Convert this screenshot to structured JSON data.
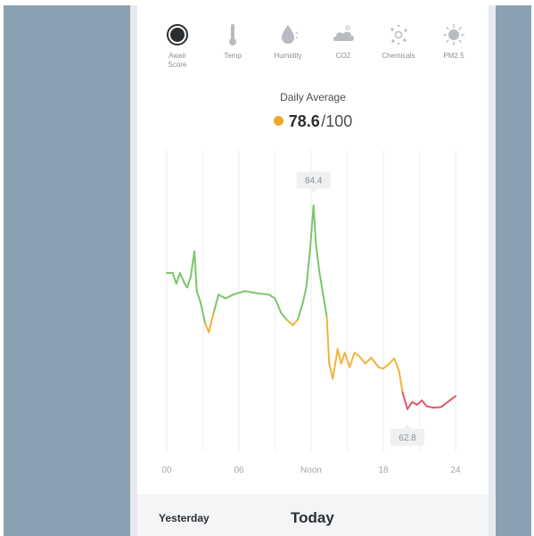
{
  "sensors": [
    {
      "label_lines": [
        "Awair",
        "Score"
      ],
      "icon": "score-ring-icon"
    },
    {
      "label_lines": [
        "Temp"
      ],
      "icon": "thermometer-icon"
    },
    {
      "label_lines": [
        "Humidity"
      ],
      "icon": "humidity-drop-icon"
    },
    {
      "label_lines": [
        "CO2"
      ],
      "icon": "co2-cloud-icon"
    },
    {
      "label_lines": [
        "Chemicals"
      ],
      "icon": "chemicals-icon"
    },
    {
      "label_lines": [
        "PM2.5"
      ],
      "icon": "pm25-icon"
    }
  ],
  "summary": {
    "label": "Daily Average",
    "value": "78.6",
    "max": "/100",
    "status_color": "#f2a52b"
  },
  "colors": {
    "good": "#7cc56b",
    "fair": "#f2b33d",
    "poor": "#e05a63"
  },
  "chart_data": {
    "type": "line",
    "x_ticks": [
      {
        "value": 0,
        "label": "00"
      },
      {
        "value": 6,
        "label": "06"
      },
      {
        "value": 12,
        "label": "Noon"
      },
      {
        "value": 18,
        "label": "18"
      },
      {
        "value": 24,
        "label": "24"
      }
    ],
    "xlim": [
      0,
      24
    ],
    "ylim": [
      55,
      96
    ],
    "grid": "vertical",
    "points": [
      [
        0.0,
        79.0
      ],
      [
        0.5,
        79.0
      ],
      [
        0.8,
        77.5
      ],
      [
        1.1,
        79.0
      ],
      [
        1.5,
        77.5
      ],
      [
        1.7,
        77.0
      ],
      [
        2.0,
        78.5
      ],
      [
        2.3,
        82.0
      ],
      [
        2.5,
        76.5
      ],
      [
        2.8,
        75.0
      ],
      [
        3.2,
        72.0
      ],
      [
        3.5,
        70.8
      ],
      [
        3.9,
        73.5
      ],
      [
        4.3,
        76.0
      ],
      [
        4.9,
        75.5
      ],
      [
        5.5,
        76.0
      ],
      [
        6.5,
        76.5
      ],
      [
        7.5,
        76.2
      ],
      [
        8.5,
        76.0
      ],
      [
        9.0,
        75.5
      ],
      [
        9.5,
        73.5
      ],
      [
        10.0,
        72.5
      ],
      [
        10.5,
        71.8
      ],
      [
        10.9,
        72.6
      ],
      [
        11.3,
        74.8
      ],
      [
        11.6,
        77.0
      ],
      [
        11.9,
        82.0
      ],
      [
        12.2,
        88.3
      ],
      [
        12.4,
        83.0
      ],
      [
        12.7,
        79.0
      ],
      [
        13.0,
        76.0
      ],
      [
        13.3,
        73.0
      ],
      [
        13.5,
        66.5
      ],
      [
        13.8,
        64.4
      ],
      [
        14.2,
        68.5
      ],
      [
        14.5,
        66.5
      ],
      [
        14.8,
        68.0
      ],
      [
        15.2,
        66.0
      ],
      [
        15.6,
        68.0
      ],
      [
        16.0,
        67.5
      ],
      [
        16.5,
        66.5
      ],
      [
        17.0,
        67.3
      ],
      [
        17.6,
        66.0
      ],
      [
        18.0,
        65.8
      ],
      [
        18.5,
        66.5
      ],
      [
        18.9,
        67.2
      ],
      [
        19.3,
        65.5
      ],
      [
        19.6,
        62.5
      ],
      [
        20.0,
        60.2
      ],
      [
        20.4,
        61.2
      ],
      [
        20.8,
        60.8
      ],
      [
        21.2,
        61.4
      ],
      [
        21.6,
        60.6
      ],
      [
        22.2,
        60.4
      ],
      [
        22.8,
        60.5
      ],
      [
        23.2,
        61.0
      ],
      [
        23.6,
        61.5
      ],
      [
        24.0,
        62.0
      ]
    ],
    "annotations": [
      {
        "x": 12.2,
        "y": 88.3,
        "label": "84.4",
        "position": "above"
      },
      {
        "x": 20.0,
        "y": 60.2,
        "label": "62.8",
        "position": "below"
      }
    ],
    "color_thresholds": {
      "good_above": 73,
      "fair_above": 63
    }
  },
  "tabs": {
    "yesterday": "Yesterday",
    "today": "Today"
  }
}
